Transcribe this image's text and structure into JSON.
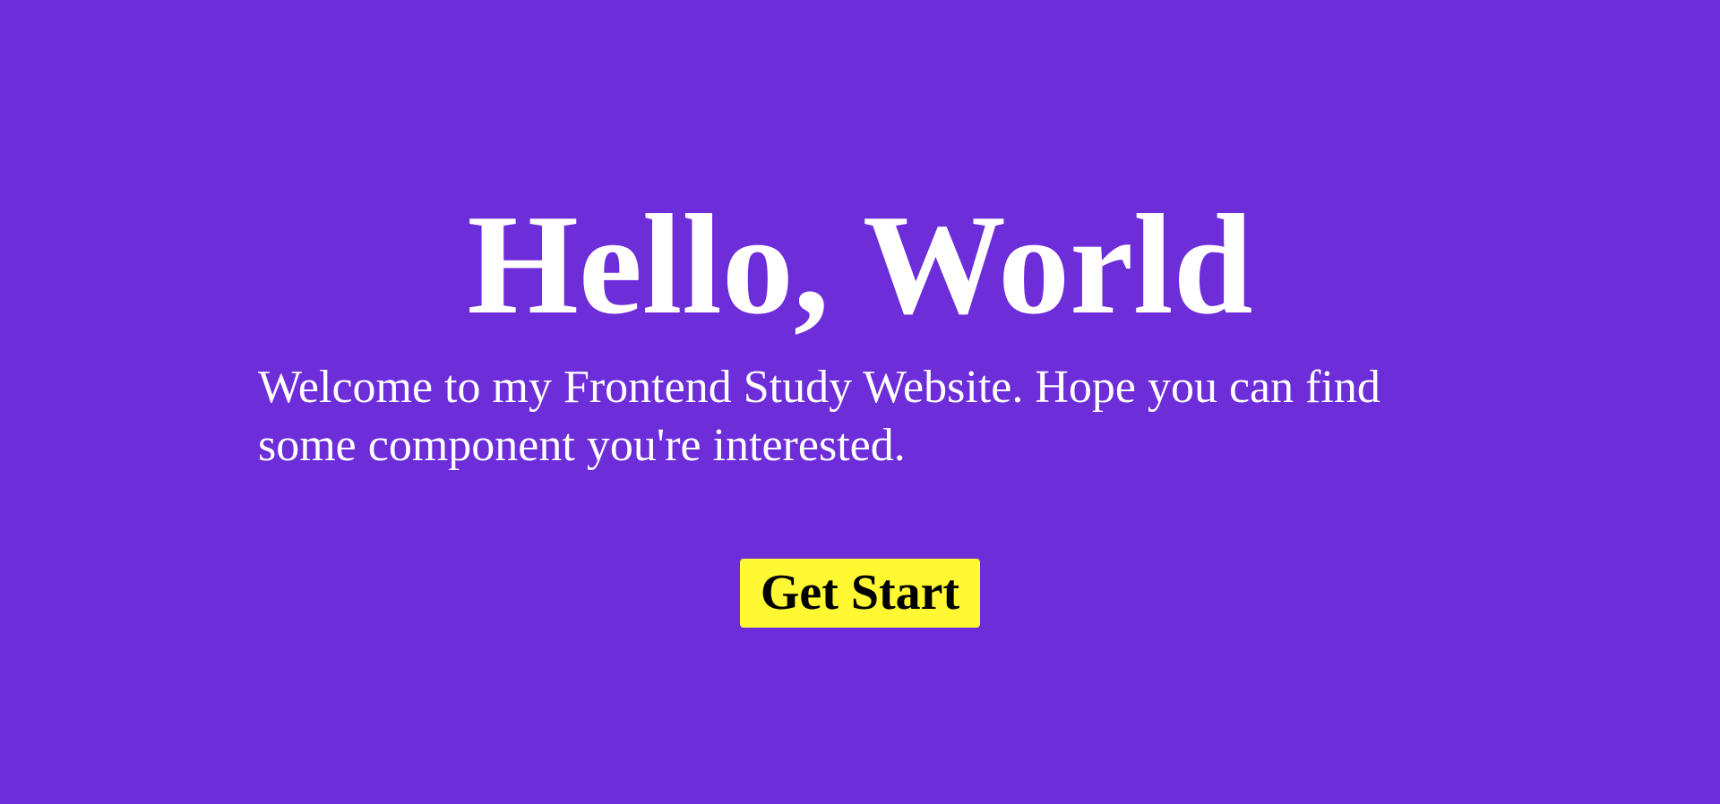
{
  "hero": {
    "title": "Hello, World",
    "subtitle": "Welcome to my Frontend Study Website. Hope you can find some component you're interested.",
    "cta_label": "Get Start"
  },
  "colors": {
    "background": "#6d2dd9",
    "text": "#ffffff",
    "button_background": "#fff832",
    "button_text": "#000000"
  }
}
